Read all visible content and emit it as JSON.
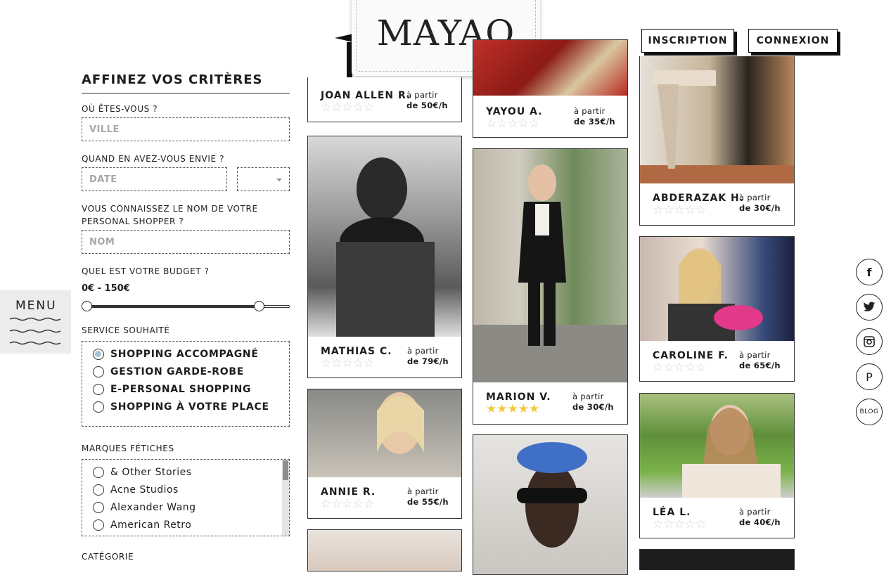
{
  "logo": {
    "text": "MAYAO"
  },
  "header": {
    "inscription": "INSCRIPTION",
    "connexion": "CONNEXION"
  },
  "menu": {
    "label": "MENU"
  },
  "filters": {
    "title": "AFFINEZ VOS CRITÈRES",
    "where_label": "OÙ ÊTES-VOUS ?",
    "where_placeholder": "VILLE",
    "when_label": "QUAND EN AVEZ-VOUS ENVIE ?",
    "date_placeholder": "DATE",
    "name_label": "VOUS CONNAISSEZ LE NOM DE VOTRE PERSONAL SHOPPER ?",
    "name_placeholder": "NOM",
    "budget_label": "QUEL EST VOTRE BUDGET ?",
    "budget_range": "0€ - 150€",
    "budget_min": 0,
    "budget_max": 150,
    "service_label": "SERVICE SOUHAITÉ",
    "services": [
      {
        "label": "SHOPPING ACCOMPAGNÉ",
        "selected": true
      },
      {
        "label": "GESTION GARDE-ROBE",
        "selected": false
      },
      {
        "label": "E-PERSONAL SHOPPING",
        "selected": false
      },
      {
        "label": "SHOPPING À VOTRE PLACE",
        "selected": false
      }
    ],
    "brands_label": "MARQUES FÉTICHES",
    "brands": [
      "& Other Stories",
      "Acne Studios",
      "Alexander Wang",
      "American Retro"
    ],
    "category_label": "CATÉGORIE"
  },
  "shoppers": [
    {
      "name": "JOAN ALLEN R.",
      "price_top": "à partir",
      "price_bottom": "de 50€/h",
      "rating": 0
    },
    {
      "name": "MATHIAS C.",
      "price_top": "à partir",
      "price_bottom": "de 79€/h",
      "rating": 0
    },
    {
      "name": "ANNIE R.",
      "price_top": "à partir",
      "price_bottom": "de 55€/h",
      "rating": 0
    },
    {
      "name": "YAYOU A.",
      "price_top": "à partir",
      "price_bottom": "de 35€/h",
      "rating": 0
    },
    {
      "name": "MARION V.",
      "price_top": "à partir",
      "price_bottom": "de 30€/h",
      "rating": 5
    },
    {
      "name": "ABDERAZAK H.",
      "price_top": "à partir",
      "price_bottom": "de 30€/h",
      "rating": 0
    },
    {
      "name": "CAROLINE F.",
      "price_top": "à partir",
      "price_bottom": "de 65€/h",
      "rating": 0
    },
    {
      "name": "LÉA L.",
      "price_top": "à partir",
      "price_bottom": "de 40€/h",
      "rating": 0
    }
  ],
  "stars": {
    "empty": "☆☆☆☆☆",
    "full": "★★★★★"
  },
  "social": {
    "facebook": "f",
    "twitter": "🐦",
    "instagram": "◙",
    "pinterest": "P",
    "blog": "BLOG"
  },
  "colors": {
    "accent_star": "#f1c93c",
    "text": "#1d1d1d",
    "menu_bg": "#ececec"
  }
}
